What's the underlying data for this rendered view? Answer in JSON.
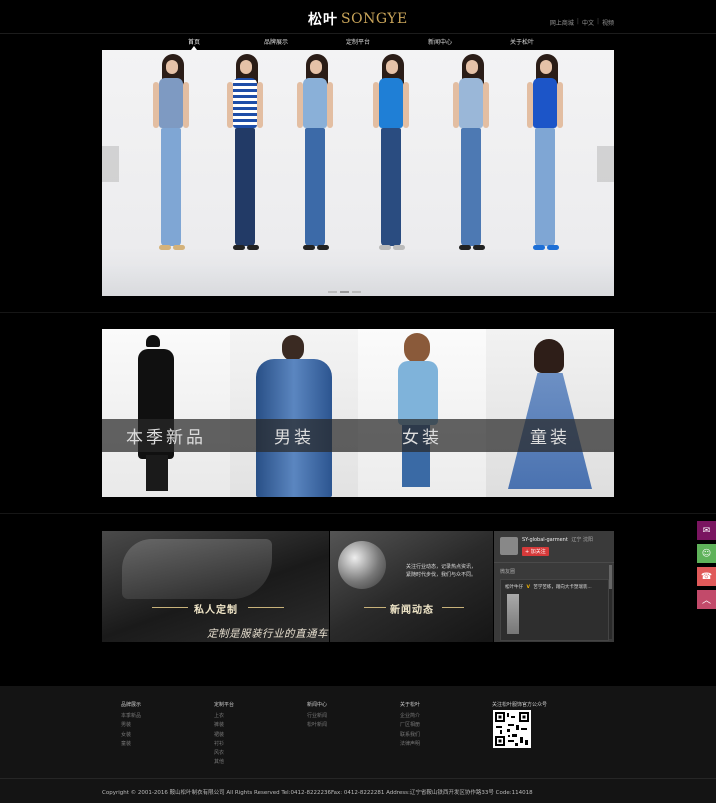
{
  "header": {
    "logo_cn": "松叶",
    "logo_en": "SONGYE",
    "top_links": [
      "网上商城",
      "中文",
      "视频"
    ]
  },
  "nav": {
    "items": [
      {
        "label": "首页",
        "active": true
      },
      {
        "label": "品牌展示",
        "active": false
      },
      {
        "label": "定制平台",
        "active": false
      },
      {
        "label": "新闻中心",
        "active": false
      },
      {
        "label": "关于松叶",
        "active": false
      }
    ]
  },
  "categories": [
    {
      "label": "本季新品"
    },
    {
      "label": "男装"
    },
    {
      "label": "女装"
    },
    {
      "label": "童装"
    }
  ],
  "custom_block": {
    "title": "私人定制",
    "slogan": "定制是服装行业的直通车"
  },
  "news_block": {
    "title": "新闻动态",
    "tagline_1": "关注行业动态，记录热点资讯，",
    "tagline_2": "紧随时代步伐，我们与众不同。"
  },
  "weibo": {
    "account": "SY-global-garment",
    "location": "辽宁 沈阳",
    "follow_label": "+ 加关注",
    "section_label": "微友圈",
    "post_name": "松叶牛仔",
    "post_text": "苦学苦练，踏向大卡塑瑞装..."
  },
  "footer": {
    "columns": [
      {
        "title": "品牌展示",
        "items": [
          "本季新品",
          "男装",
          "女装",
          "童装"
        ]
      },
      {
        "title": "定制平台",
        "items": [
          "上衣",
          "裤装",
          "裙装",
          "衬衫",
          "风衣",
          "其他"
        ]
      },
      {
        "title": "新闻中心",
        "items": [
          "行业新闻",
          "松叶新闻"
        ]
      },
      {
        "title": "关于松叶",
        "items": [
          "企业简介",
          "厂区相册",
          "联系我们",
          "法律声明"
        ]
      }
    ],
    "qr_title": "关注松叶服饰官方公众号",
    "copyright": "Copyright © 2001-2016 鞍山松叶制衣有限公司 All Rights Reserved Tel:0412-8222236Fax: 0412-8222281 Address:辽宁省鞍山铁西开发区协作路33号 Code:114018"
  },
  "colors": {
    "background": "#000000",
    "logo_accent": "#c9a55a",
    "side_wechat": "#7a1560",
    "side_qq": "#5fb25a",
    "side_phone": "#e05a5a",
    "side_top": "#c24a6a"
  },
  "side_tools": [
    "wechat-icon",
    "qq-icon",
    "phone-icon",
    "back-to-top-icon"
  ]
}
